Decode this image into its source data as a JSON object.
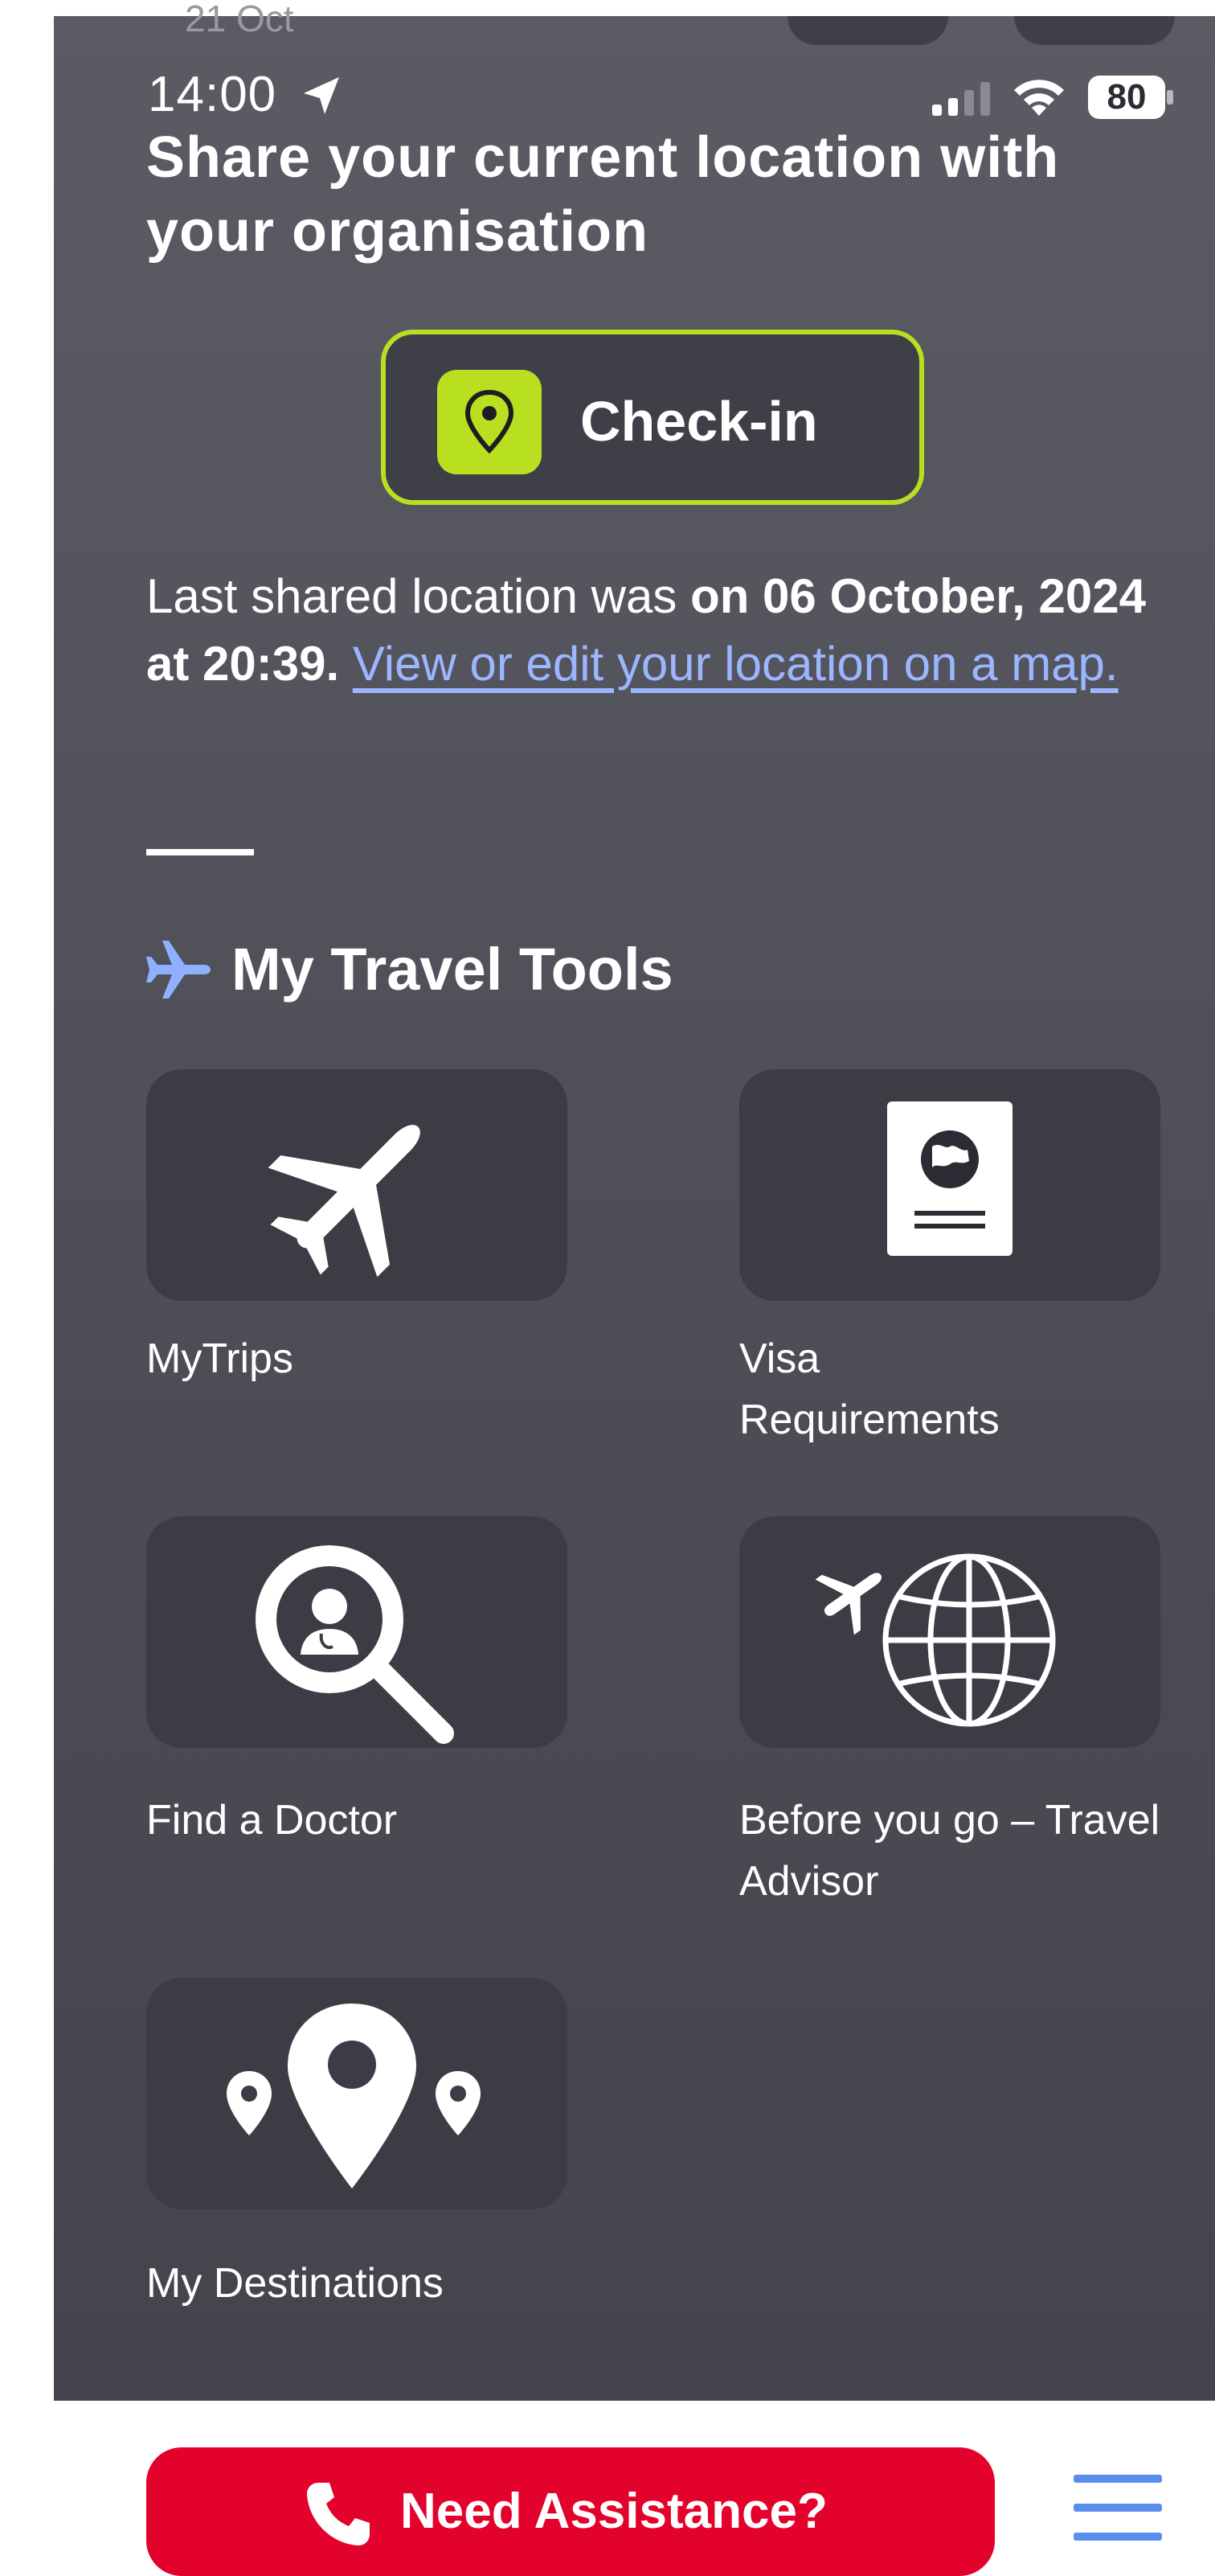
{
  "peek": {
    "date": "21 Oct"
  },
  "status_bar": {
    "time": "14:00",
    "battery": "80"
  },
  "checkin_section": {
    "title": "Share your current location with your organisation",
    "button_label": "Check-in",
    "accent": "#b8e021",
    "last_shared_prefix": "Last shared location was ",
    "last_shared_when": "on 06 October, 2024 at 20:39.",
    "map_link": "View or edit your location on a map."
  },
  "travel_tools": {
    "title": "My Travel Tools",
    "icon": "airplane-icon",
    "tiles": [
      {
        "label": "MyTrips",
        "icon": "airplane-icon"
      },
      {
        "label": "Visa Requirements",
        "icon": "passport-icon"
      },
      {
        "label": "Find a Doctor",
        "icon": "doctor-search-icon"
      },
      {
        "label": "Before you go – Travel Advisor",
        "icon": "globe-airplane-icon"
      },
      {
        "label": "My Destinations",
        "icon": "location-pins-icon"
      }
    ]
  },
  "footer": {
    "assistance_label": "Need Assistance?",
    "assistance_color": "#e3022c",
    "menu_icon": "hamburger-menu-icon",
    "menu_color": "#5b8def"
  }
}
